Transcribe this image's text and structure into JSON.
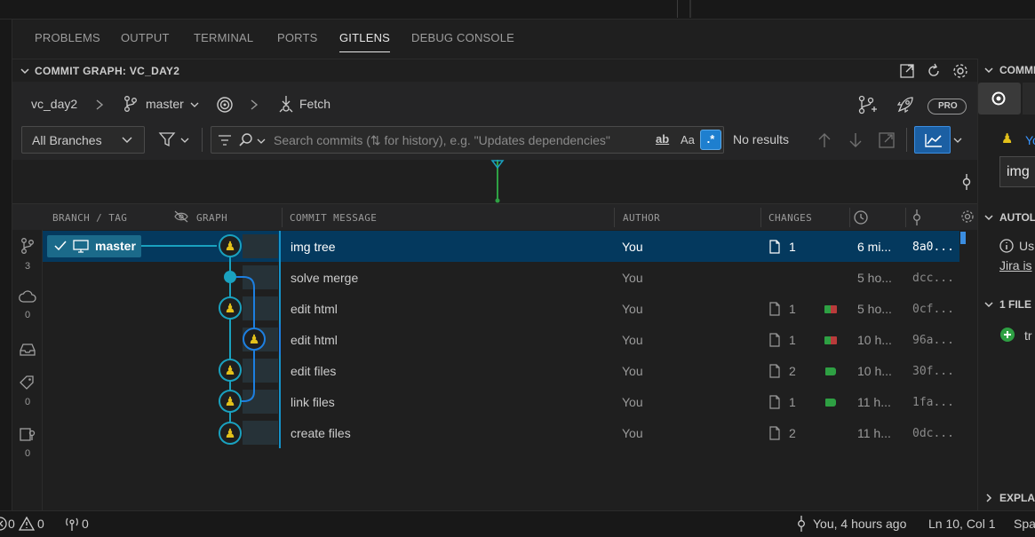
{
  "panel": {
    "tabs": [
      {
        "label": "PROBLEMS"
      },
      {
        "label": "OUTPUT"
      },
      {
        "label": "TERMINAL"
      },
      {
        "label": "PORTS"
      },
      {
        "label": "GITLENS",
        "active": true
      },
      {
        "label": "DEBUG CONSOLE"
      }
    ]
  },
  "section": {
    "title": "COMMIT GRAPH: VC_DAY2"
  },
  "toolbar": {
    "repo": "vc_day2",
    "branch": "master",
    "fetch_label": "Fetch",
    "pro_badge": "PRO",
    "branch_filter": "All Branches",
    "search_placeholder": "Search commits (⇅ for history), e.g. \"Updates dependencies\"",
    "match_word": "ab",
    "match_case": "Aa",
    "regex": ".*",
    "results": "No results"
  },
  "columns": {
    "branch_tag": "BRANCH / TAG",
    "graph": "GRAPH",
    "commit_message": "COMMIT MESSAGE",
    "author": "AUTHOR",
    "changes": "CHANGES"
  },
  "rail": {
    "counts": [
      "3",
      "0",
      "0",
      "0",
      "0"
    ]
  },
  "branch_tag": {
    "name": "master"
  },
  "commits": [
    {
      "message": "img tree",
      "author": "You",
      "files": "1",
      "date": "6 mi...",
      "sha": "8a0...",
      "added": 0,
      "deleted": 0
    },
    {
      "message": "solve merge",
      "author": "You",
      "files": "",
      "date": "5 ho...",
      "sha": "dcc...",
      "added": 0,
      "deleted": 0
    },
    {
      "message": "edit html",
      "author": "You",
      "files": "1",
      "date": "5 ho...",
      "sha": "0cf...",
      "added": 1,
      "deleted": 1
    },
    {
      "message": "edit html",
      "author": "You",
      "files": "1",
      "date": "10 h...",
      "sha": "96a...",
      "added": 1,
      "deleted": 1
    },
    {
      "message": "edit files",
      "author": "You",
      "files": "2",
      "date": "10 h...",
      "sha": "30f...",
      "added": 1,
      "deleted": 0
    },
    {
      "message": "link files",
      "author": "You",
      "files": "1",
      "date": "11 h...",
      "sha": "1fa...",
      "added": 1,
      "deleted": 0
    },
    {
      "message": "create files",
      "author": "You",
      "files": "2",
      "date": "11 h...",
      "sha": "0dc...",
      "added": 0,
      "deleted": 0
    }
  ],
  "right_panel": {
    "commit_head": "COMMI",
    "author_label": "Yo",
    "commit_title": "img",
    "autolinks_head": "AUTOL",
    "autolinks_info": "Us",
    "jira_link": "Jira is",
    "files_head": "1 FILE",
    "file_name": "tr",
    "explain_head": "EXPLA"
  },
  "status": {
    "errors": "0",
    "warnings": "0",
    "ports": "0",
    "blame": "You, 4 hours ago",
    "position": "Ln 10, Col 1",
    "spaces": "Spa"
  },
  "colors": {
    "accent": "#0e639c",
    "selected_row": "#04395e",
    "graph_line": "#1aa1bf",
    "graph_branch": "#1d7fe0",
    "added": "#2ea043",
    "deleted": "#b93b3b",
    "minimap_line": "#2ea043"
  }
}
